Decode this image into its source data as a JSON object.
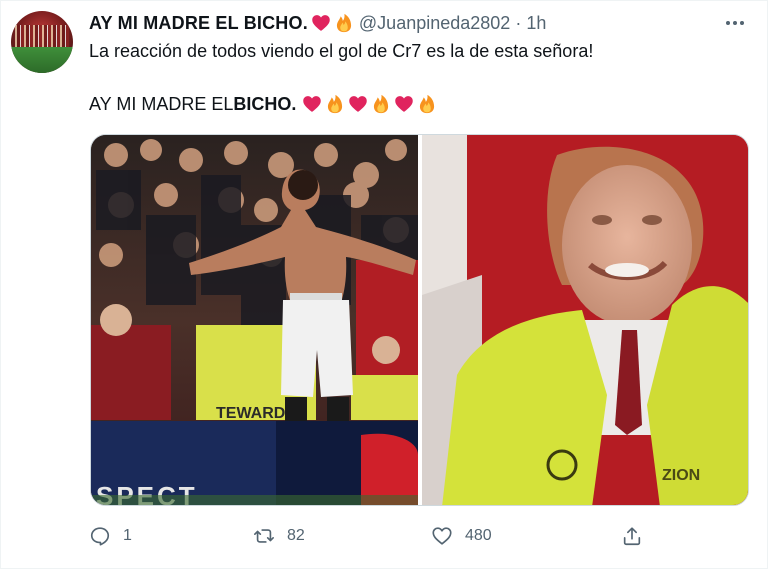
{
  "tweet": {
    "display_name": "AY MI MADRE EL BICHO.",
    "name_emojis": [
      "heart",
      "fire"
    ],
    "handle": "@Juanpineda2802",
    "separator": "·",
    "time": "1h",
    "text_line1": "La reacción de todos viendo el gol de Cr7 es la de esta señora!",
    "text_line2_prefix": "AY MI MADRE EL ",
    "text_line2_bold": "BICHO.",
    "line2_emojis": [
      "heart",
      "fire",
      "heart",
      "fire",
      "heart",
      "fire"
    ],
    "media": [
      {
        "kind": "photo",
        "description": "player-celebrating-in-front-of-crowd",
        "visible_text": [
          "TEWARD",
          "SPECT"
        ]
      },
      {
        "kind": "photo",
        "description": "smiling-steward-closeup"
      }
    ]
  },
  "actions": {
    "reply": {
      "icon": "reply-icon",
      "count": "1"
    },
    "retweet": {
      "icon": "retweet-icon",
      "count": "82"
    },
    "like": {
      "icon": "heart-outline-icon",
      "count": "480"
    },
    "share": {
      "icon": "share-icon"
    }
  },
  "colors": {
    "text": "#0f1419",
    "secondary": "#536471",
    "heart": "#e0245e",
    "fire": "#f7931e"
  }
}
